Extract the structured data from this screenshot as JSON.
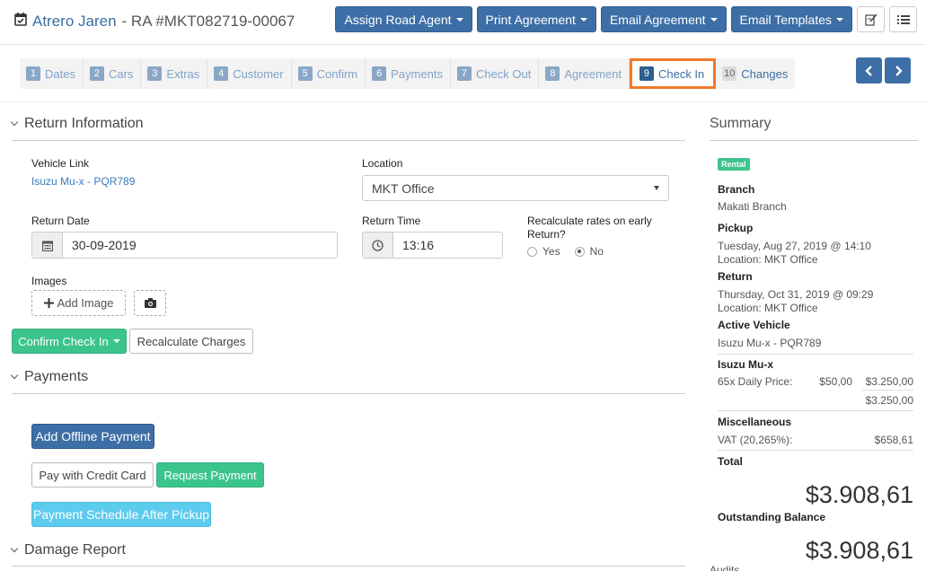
{
  "header": {
    "customer_name": "Atrero Jaren",
    "ra_text": "- RA #MKT082719-00067",
    "buttons": [
      "Assign Road Agent",
      "Print Agreement",
      "Email Agreement",
      "Email Templates"
    ]
  },
  "steps": [
    {
      "num": "1",
      "label": "Dates"
    },
    {
      "num": "2",
      "label": "Cars"
    },
    {
      "num": "3",
      "label": "Extras"
    },
    {
      "num": "4",
      "label": "Customer"
    },
    {
      "num": "5",
      "label": "Confirm"
    },
    {
      "num": "6",
      "label": "Payments"
    },
    {
      "num": "7",
      "label": "Check Out"
    },
    {
      "num": "8",
      "label": "Agreement"
    },
    {
      "num": "9",
      "label": "Check In"
    },
    {
      "num": "10",
      "label": "Changes"
    }
  ],
  "return_info": {
    "section_title": "Return Information",
    "vehicle_link_label": "Vehicle Link",
    "vehicle_link_value": "Isuzu Mu-x - PQR789",
    "location_label": "Location",
    "location_value": "MKT Office",
    "return_date_label": "Return Date",
    "return_date_value": "30-09-2019",
    "return_time_label": "Return Time",
    "return_time_value": "13:16",
    "recalc_label": "Recalculate rates on early Return?",
    "radio_yes": "Yes",
    "radio_no": "No",
    "images_label": "Images",
    "add_image": "Add Image",
    "confirm_btn": "Confirm Check In",
    "recalc_btn": "Recalculate Charges"
  },
  "payments": {
    "section_title": "Payments",
    "add_offline": "Add Offline Payment",
    "pay_credit": "Pay with Credit Card",
    "request_payment": "Request Payment",
    "schedule": "Payment Schedule After Pickup"
  },
  "damage": {
    "section_title": "Damage Report"
  },
  "summary": {
    "title": "Summary",
    "badge": "Rental",
    "branch_label": "Branch",
    "branch_value": "Makati Branch",
    "pickup_label": "Pickup",
    "pickup_date": "Tuesday, Aug 27, 2019 @ 14:10",
    "pickup_location": "Location: MKT Office",
    "return_label": "Return",
    "return_date": "Thursday, Oct 31, 2019 @ 09:29",
    "return_location": "Location: MKT Office",
    "active_vehicle_label": "Active Vehicle",
    "active_vehicle_value": "Isuzu Mu-x - PQR789",
    "car_label": "Isuzu Mu-x",
    "daily_label": "65x Daily Price:",
    "daily_price": "$50,00",
    "daily_total": "$3.250,00",
    "car_subtotal": "$3.250,00",
    "misc_label": "Miscellaneous",
    "vat_label": "VAT (20,265%):",
    "vat_value": "$658,61",
    "total_label": "Total",
    "total_value": "$3.908,61",
    "outstanding_label": "Outstanding Balance",
    "outstanding_value": "$3.908,61",
    "audits_label": "Audits"
  },
  "colors": {
    "primary": "#3d6ea6",
    "success": "#3cc48d",
    "info": "#5ccbee",
    "highlight": "#f07a2a",
    "link": "#3a7bbf"
  }
}
